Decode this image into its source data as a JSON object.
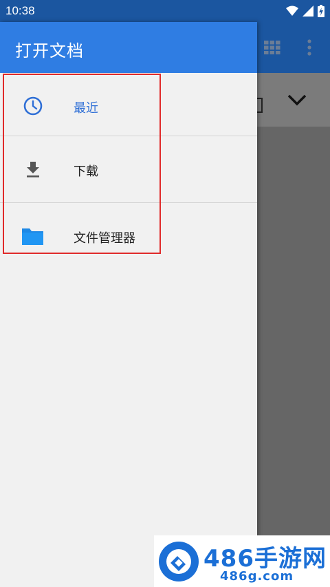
{
  "status_bar": {
    "time": "10:38",
    "icons": [
      "wifi-icon",
      "signal-icon",
      "battery-charging-icon"
    ]
  },
  "drawer": {
    "title": "打开文档",
    "items": [
      {
        "label": "最近",
        "icon": "clock-icon",
        "active": true
      },
      {
        "label": "下载",
        "icon": "download-icon",
        "active": false
      },
      {
        "label": "文件管理器",
        "icon": "folder-icon",
        "active": false
      }
    ]
  },
  "background_toolbar": {
    "icons": [
      "grid-view-icon",
      "more-vert-icon",
      "chevron-down-icon"
    ]
  },
  "watermark": {
    "title": "486手游网",
    "url": "486g.com"
  },
  "colors": {
    "header_blue": "#2f7de3",
    "status_blue": "#1b56a0",
    "active_text": "#2f6fd6",
    "highlight_red": "#e02a2a",
    "folder_blue": "#1e88e5"
  }
}
